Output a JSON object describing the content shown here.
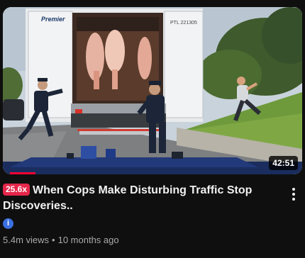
{
  "video": {
    "duration": "42:51",
    "multiplier": "25.6x",
    "title": "When Cops Make Disturbing Traffic Stop Discoveries..",
    "verified_icon": "i",
    "views": "5.4m views",
    "separator": "•",
    "age": "10 months ago",
    "truck_brand": "Premier",
    "truck_number": "PTL 221305"
  },
  "colors": {
    "multiplier_bg": "#e4264a",
    "verified_bg": "#3b6fe0",
    "progress": "#ff0033"
  },
  "icons": {
    "menu": "more-vert-icon",
    "verified": "verified-badge-icon"
  }
}
